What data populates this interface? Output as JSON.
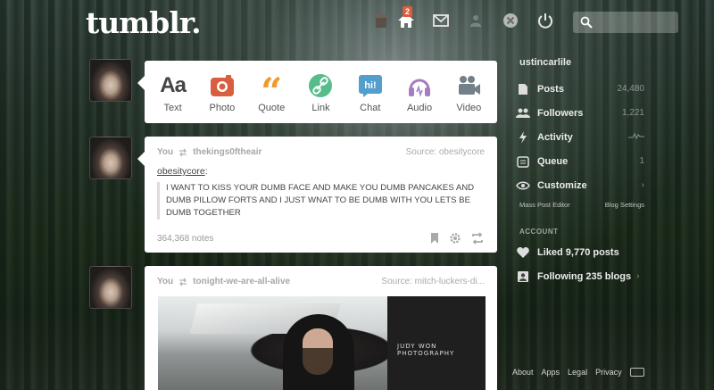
{
  "header": {
    "logo": "tumblr.",
    "inbox_badge": "2",
    "icons": [
      "gift-icon",
      "home-icon",
      "mail-icon",
      "people-icon",
      "close-icon",
      "power-icon",
      "search-icon"
    ]
  },
  "post_types": [
    {
      "label": "Text",
      "icon": "text-icon",
      "color": "#444444"
    },
    {
      "label": "Photo",
      "icon": "camera-icon",
      "color": "#d95e40"
    },
    {
      "label": "Quote",
      "icon": "quote-icon",
      "color": "#f2992e"
    },
    {
      "label": "Link",
      "icon": "link-icon",
      "color": "#56bc8a"
    },
    {
      "label": "Chat",
      "icon": "chat-icon",
      "color": "#529ecc"
    },
    {
      "label": "Audio",
      "icon": "headphones-icon",
      "color": "#a77dc2"
    },
    {
      "label": "Video",
      "icon": "video-camera-icon",
      "color": "#748089"
    }
  ],
  "posts": [
    {
      "reblogger": "You",
      "reblogged_from": "thekings0ftheair",
      "source": "Source: obesitycore",
      "author": "obesitycore",
      "author_suffix": ":",
      "quote": "I WANT TO KISS YOUR DUMB FACE AND MAKE YOU DUMB PANCAKES AND DUMB PILLOW FORTS AND I JUST WNAT TO BE DUMB WITH YOU LETS BE DUMB TOGETHER",
      "notes": "364,368 notes"
    },
    {
      "reblogger": "You",
      "reblogged_from": "tonight-we-are-all-alive",
      "source": "Source: mitch-luckers-di...",
      "watermark": "JUDY WON PHOTOGRAPHY"
    }
  ],
  "sidebar": {
    "blog_name": "ustincarlile",
    "items": [
      {
        "label": "Posts",
        "count": "24,480",
        "icon": "document-icon"
      },
      {
        "label": "Followers",
        "count": "1,221",
        "icon": "people-icon"
      },
      {
        "label": "Activity",
        "count": "",
        "icon": "lightning-icon"
      },
      {
        "label": "Queue",
        "count": "1",
        "icon": "queue-icon"
      },
      {
        "label": "Customize",
        "count": "",
        "icon": "eye-icon"
      }
    ],
    "mass_post_editor": "Mass Post Editor",
    "blog_settings": "Blog Settings",
    "account_heading": "ACCOUNT",
    "account_items": [
      {
        "label": "Liked 9,770 posts",
        "icon": "heart-icon"
      },
      {
        "label": "Following 235 blogs",
        "icon": "following-icon"
      }
    ]
  },
  "footer": {
    "links": [
      "About",
      "Apps",
      "Legal",
      "Privacy"
    ]
  }
}
